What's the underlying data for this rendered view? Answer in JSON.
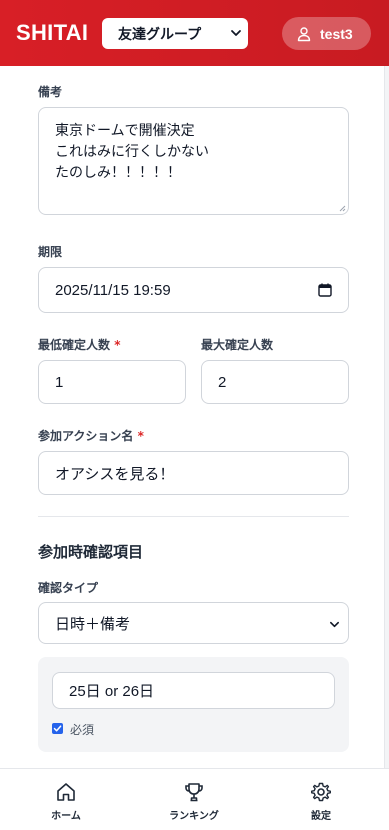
{
  "header": {
    "logo": "SHITAI",
    "group_selected": "友達グループ",
    "username": "test3",
    "colors": {
      "brand": "#d81f26"
    }
  },
  "form": {
    "notes": {
      "label": "備考",
      "lines": [
        "東京ドームで開催決定",
        "これはみに行くしかない",
        "たのしみ！！！！！"
      ]
    },
    "deadline": {
      "label": "期限",
      "value": "2025/11/15 19:59"
    },
    "min_people": {
      "label": "最低確定人数",
      "required_mark": "*",
      "value": "1"
    },
    "max_people": {
      "label": "最大確定人数",
      "value": "2"
    },
    "action_name": {
      "label": "参加アクション名",
      "required_mark": "*",
      "value": "オアシスを見る！"
    },
    "confirm_section": {
      "title": "参加時確認項目",
      "type_label": "確認タイプ",
      "type_value": "日時＋備考",
      "option_value": "25日 or 26日",
      "required_label": "必須",
      "required_checked": true
    }
  },
  "footer": {
    "items": [
      {
        "label": "ホーム",
        "icon": "home-icon"
      },
      {
        "label": "ランキング",
        "icon": "trophy-icon"
      },
      {
        "label": "設定",
        "icon": "gear-icon"
      }
    ]
  }
}
